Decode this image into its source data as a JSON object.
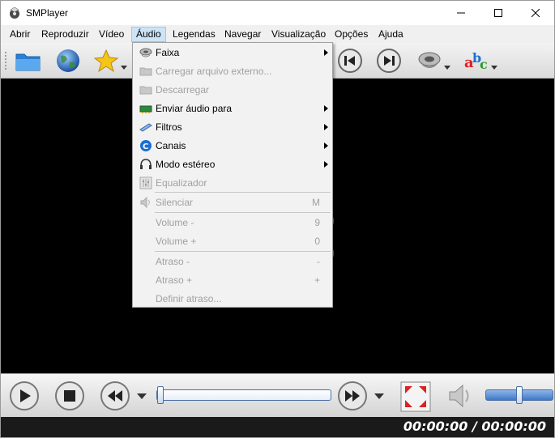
{
  "window": {
    "title": "SMPlayer"
  },
  "menubar": {
    "items": [
      {
        "label": "Abrir"
      },
      {
        "label": "Reproduzir"
      },
      {
        "label": "Vídeo"
      },
      {
        "label": "Áudio"
      },
      {
        "label": "Legendas"
      },
      {
        "label": "Navegar"
      },
      {
        "label": "Visualização"
      },
      {
        "label": "Opções"
      },
      {
        "label": "Ajuda"
      }
    ],
    "active": "Áudio"
  },
  "audio_menu": {
    "items": [
      {
        "label": "Faixa",
        "enabled": true,
        "submenu": true,
        "icon": "track-icon"
      },
      {
        "label": "Carregar arquivo externo...",
        "enabled": false,
        "icon": "folder-icon"
      },
      {
        "label": "Descarregar",
        "enabled": false,
        "icon": "folder-icon"
      },
      {
        "label": "Enviar áudio para",
        "enabled": true,
        "submenu": true,
        "icon": "audio-card-icon"
      },
      {
        "label": "Filtros",
        "enabled": true,
        "submenu": true,
        "icon": "filters-icon"
      },
      {
        "label": "Canais",
        "enabled": true,
        "submenu": true,
        "icon": "channels-icon"
      },
      {
        "label": "Modo estéreo",
        "enabled": true,
        "submenu": true,
        "icon": "headphones-icon"
      },
      {
        "label": "Equalizador",
        "enabled": false,
        "icon": "equalizer-icon"
      },
      {
        "label": "Silenciar",
        "enabled": false,
        "shortcut": "M",
        "icon": "mute-icon"
      },
      {
        "label": "Volume -",
        "enabled": false,
        "shortcut": "9"
      },
      {
        "label": "Volume +",
        "enabled": false,
        "shortcut": "0"
      },
      {
        "label": "Atraso -",
        "enabled": false,
        "shortcut": "-"
      },
      {
        "label": "Atraso +",
        "enabled": false,
        "shortcut": "+"
      },
      {
        "label": "Definir atraso...",
        "enabled": false
      }
    ]
  },
  "status": {
    "time": "00:00:00 / 00:00:00"
  },
  "volume": {
    "level": 0.5
  },
  "seek": {
    "position": 0
  }
}
